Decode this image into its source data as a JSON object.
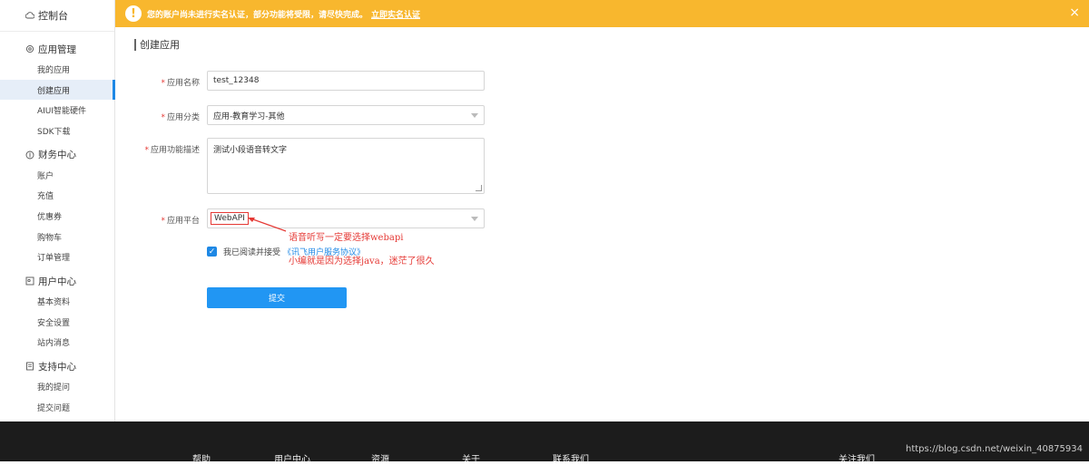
{
  "sidebar": {
    "console": "控制台",
    "groups": [
      {
        "title": "应用管理",
        "items": [
          "我的应用",
          "创建应用",
          "AIUI智能硬件",
          "SDK下载"
        ]
      },
      {
        "title": "财务中心",
        "items": [
          "账户",
          "充值",
          "优惠券",
          "购物车",
          "订单管理"
        ]
      },
      {
        "title": "用户中心",
        "items": [
          "基本资料",
          "安全设置",
          "站内消息"
        ]
      },
      {
        "title": "支持中心",
        "items": [
          "我的提问",
          "提交问题"
        ]
      }
    ],
    "active": "创建应用"
  },
  "banner": {
    "text": "您的账户尚未进行实名认证，部分功能将受限，请尽快完成。",
    "link": "立即实名认证",
    "close": "×",
    "warn": "!"
  },
  "form": {
    "title": "创建应用",
    "app_name_label": "应用名称",
    "app_name_value": "test_12348",
    "category_label": "应用分类",
    "category_value": "应用-教育学习-其他",
    "desc_label": "应用功能描述",
    "desc_value": "测试小段语音转文字",
    "platform_label": "应用平台",
    "platform_value": "WebAPI",
    "required": "*",
    "agree_text": "我已阅读并接受",
    "agree_link": "《讯飞用户服务协议》",
    "submit": "提交",
    "check": "✓"
  },
  "annotations": {
    "line1": "语音听写一定要选择webapi",
    "line2": "小编就是因为选择java，迷茫了很久"
  },
  "footer": {
    "nav": [
      "帮助",
      "用户中心",
      "资源",
      "关于",
      "联系我们",
      "关注我们"
    ],
    "watermark": "https://blog.csdn.net/weixin_40875934"
  },
  "colors": {
    "accent": "#2196f3",
    "banner": "#f8b72e",
    "annotation": "#e53935"
  }
}
